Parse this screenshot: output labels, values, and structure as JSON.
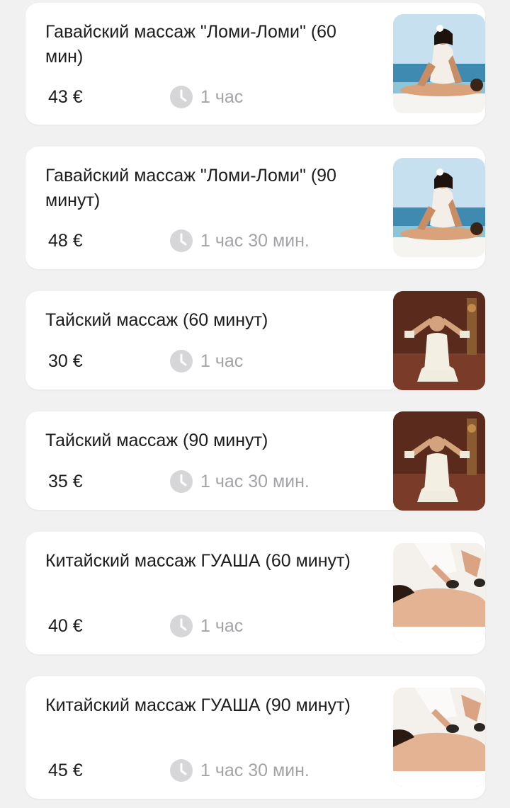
{
  "services": [
    {
      "title": "Гавайский массаж \"Ломи-Ломи\" (60 мин)",
      "price": "43 €",
      "duration": "1 час",
      "image": "lomi-lomi-massage-photo"
    },
    {
      "title": "Гавайский массаж \"Ломи-Ломи\" (90 минут)",
      "price": "48 €",
      "duration": "1 час 30 мин.",
      "image": "lomi-lomi-massage-photo"
    },
    {
      "title": "Тайский массаж (60 минут)",
      "price": "30 €",
      "duration": "1 час",
      "image": "thai-massage-photo"
    },
    {
      "title": "Тайский массаж (90 минут)",
      "price": "35 €",
      "duration": "1 час 30 мин.",
      "image": "thai-massage-photo"
    },
    {
      "title": "Китайский массаж ГУАША (60 минут)",
      "price": "40 €",
      "duration": "1 час",
      "image": "guasha-massage-photo"
    },
    {
      "title": "Китайский массаж ГУАША (90 минут)",
      "price": "45 €",
      "duration": "1 час 30 мин.",
      "image": "guasha-massage-photo"
    }
  ],
  "colors": {
    "background": "#f1f1f2",
    "card": "#ffffff",
    "text": "#1d1d1f",
    "muted": "#a4a4a8",
    "clock": "#d6d6d9"
  },
  "icons": {
    "duration": "clock-icon"
  }
}
